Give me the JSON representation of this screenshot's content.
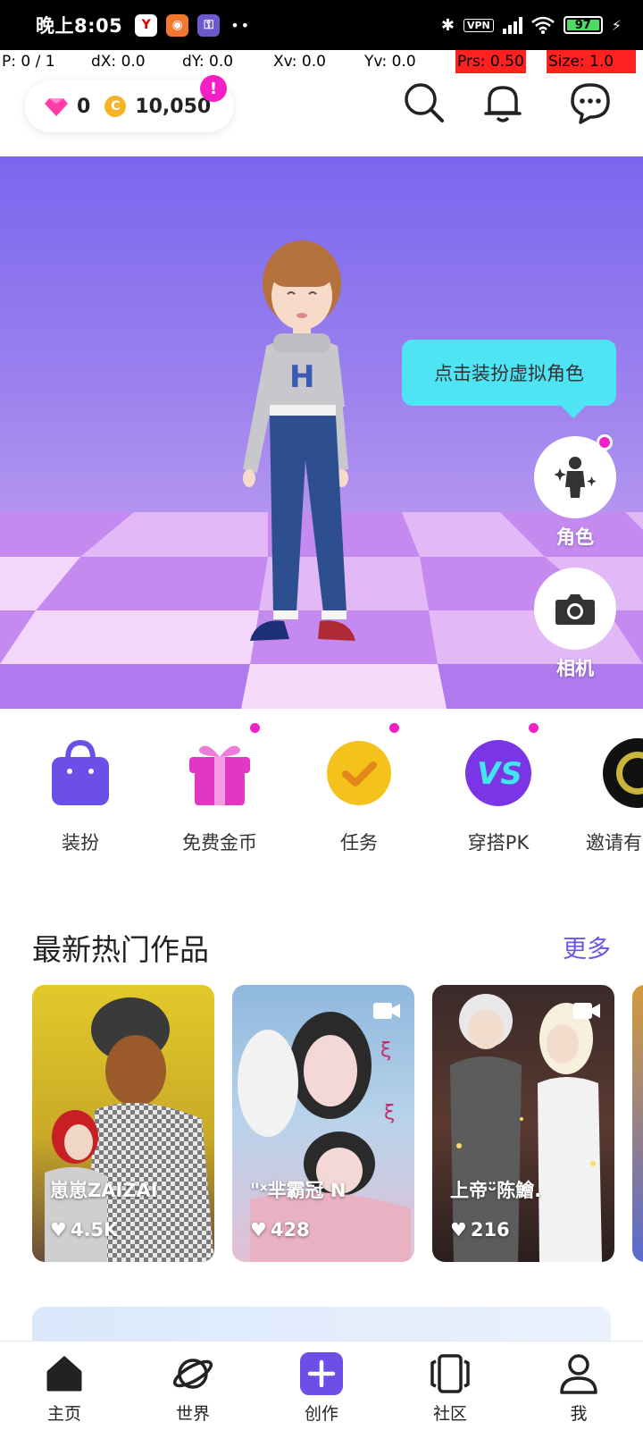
{
  "status_bar": {
    "time": "晚上8:05",
    "vpn": "VPN",
    "battery": "97"
  },
  "debug": {
    "pointer": "P: 0 / 1",
    "dx": "dX: 0.0",
    "dy": "dY: 0.0",
    "xv": "Xv: 0.0",
    "yv": "Yv: 0.0",
    "prs": "Prs: 0.50",
    "size": "Size: 1.0"
  },
  "header": {
    "gems": "0",
    "coins": "10,050",
    "alert": "!"
  },
  "hero": {
    "tooltip": "点击装扮虚拟角色",
    "character_label": "角色",
    "camera_label": "相机"
  },
  "shortcuts": [
    {
      "label": "装扮",
      "icon": "shopping-bag-icon"
    },
    {
      "label": "免费金币",
      "icon": "gift-icon"
    },
    {
      "label": "任务",
      "icon": "check-task-icon"
    },
    {
      "label": "穿搭PK",
      "icon": "vs-icon"
    },
    {
      "label": "邀请有",
      "icon": "invite-icon"
    }
  ],
  "section": {
    "title": "最新热门作品",
    "more": "更多"
  },
  "cards": [
    {
      "title": "崽崽ZAIZAI",
      "likes": "4.5K"
    },
    {
      "title": "\"ˣ芈霸冠 N",
      "likes": "428"
    },
    {
      "title": "上帝ᵕ̈陈鱠.",
      "likes": "216"
    }
  ],
  "bottom_nav": [
    {
      "label": "主页"
    },
    {
      "label": "世界"
    },
    {
      "label": "创作"
    },
    {
      "label": "社区"
    },
    {
      "label": "我"
    }
  ],
  "colors": {
    "accent": "#6b56e8",
    "badge": "#f21ec6",
    "tooltip": "#4ee4f4"
  }
}
